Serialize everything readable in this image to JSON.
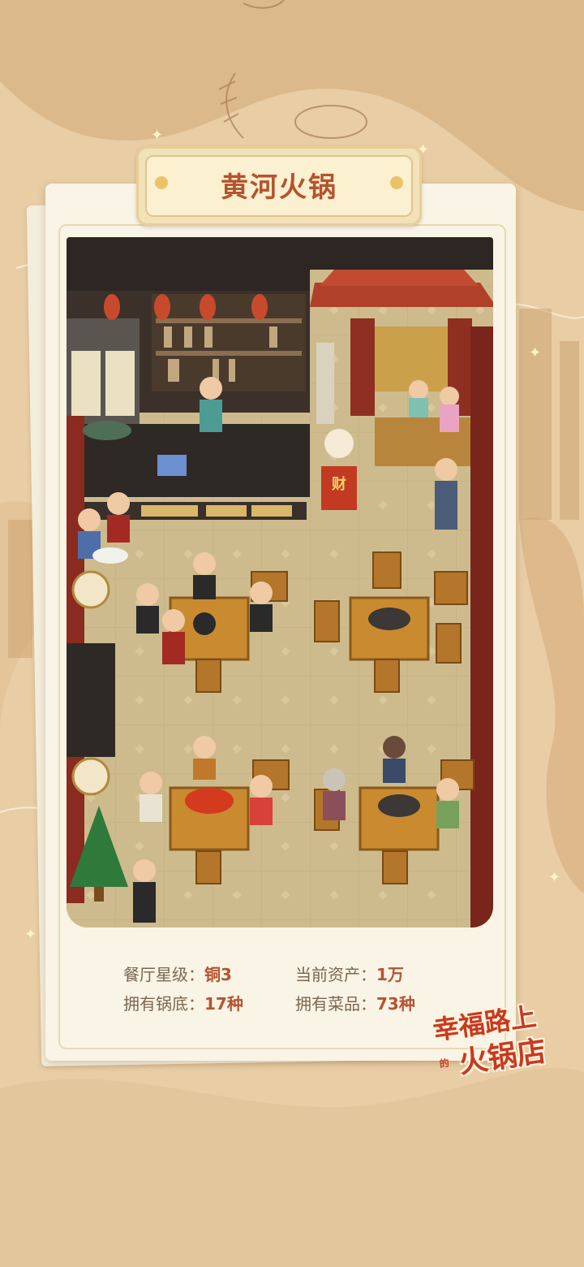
{
  "restaurant": {
    "name": "黄河火锅"
  },
  "stats": [
    {
      "label": "餐厅星级：",
      "value": "铜3"
    },
    {
      "label": "当前资产：",
      "value": "1万"
    },
    {
      "label": "拥有锅底：",
      "value": "17种"
    },
    {
      "label": "拥有菜品：",
      "value": "73种"
    }
  ],
  "scene": {
    "cashier_sign": "财"
  },
  "logo": {
    "line1": "幸福路上",
    "small": "的",
    "line2": "火锅店"
  },
  "colors": {
    "accent": "#b5532e",
    "background": "#e6c9a0",
    "card": "#f9f4e6"
  }
}
